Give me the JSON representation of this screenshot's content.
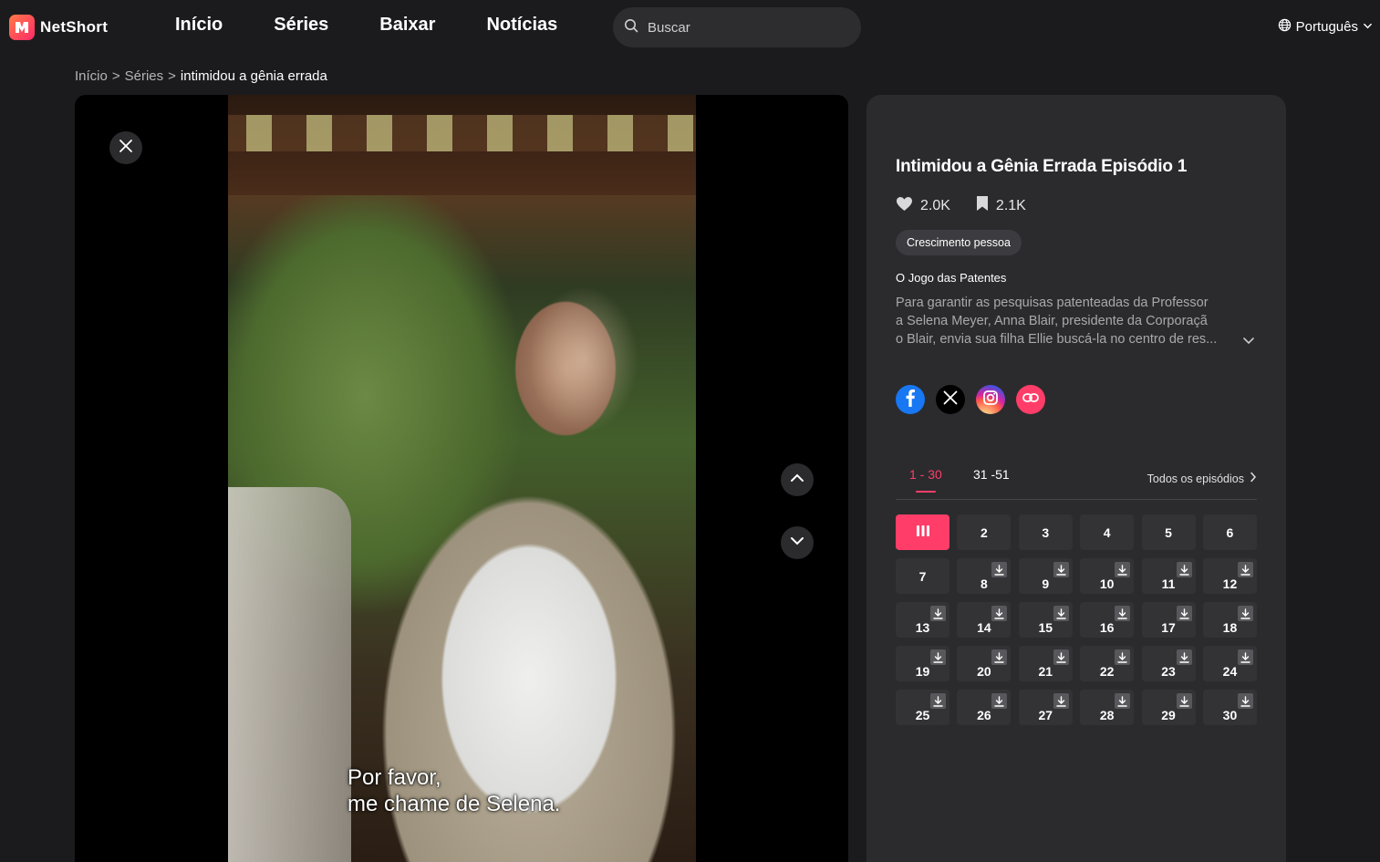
{
  "header": {
    "logo_text": "NetShort",
    "nav": [
      "Início",
      "Séries",
      "Baixar",
      "Notícias"
    ],
    "search_placeholder": "Buscar",
    "language": "Português"
  },
  "breadcrumb": {
    "home": "Início",
    "sep1": ">",
    "series": "Séries",
    "sep2": ">",
    "current": "intimidou a gênia errada"
  },
  "player": {
    "subtitle_line1": "Por favor,",
    "subtitle_line2": "me chame de Selena."
  },
  "info": {
    "title": "Intimidou a Gênia Errada Episódio 1",
    "likes": "2.0K",
    "saves": "2.1K",
    "tag": "Crescimento pessoa",
    "subheading": "O Jogo das Patentes",
    "description_lines": [
      "Para garantir as pesquisas patenteadas da Professor",
      "a Selena Meyer, Anna Blair, presidente da Corporaçã",
      "o Blair, envia sua filha Ellie buscá-la no centro de res..."
    ],
    "social": [
      "facebook-icon",
      "x-icon",
      "instagram-icon",
      "link-icon"
    ]
  },
  "episodes": {
    "tabs": [
      "1 - 30",
      "31 -51"
    ],
    "active_tab": "1 - 30",
    "all_label": "Todos os episódios",
    "playing": 1,
    "list": [
      {
        "n": "1",
        "dl": false
      },
      {
        "n": "2",
        "dl": false
      },
      {
        "n": "3",
        "dl": false
      },
      {
        "n": "4",
        "dl": false
      },
      {
        "n": "5",
        "dl": false
      },
      {
        "n": "6",
        "dl": false
      },
      {
        "n": "7",
        "dl": false
      },
      {
        "n": "8",
        "dl": true
      },
      {
        "n": "9",
        "dl": true
      },
      {
        "n": "10",
        "dl": true
      },
      {
        "n": "11",
        "dl": true
      },
      {
        "n": "12",
        "dl": true
      },
      {
        "n": "13",
        "dl": true
      },
      {
        "n": "14",
        "dl": true
      },
      {
        "n": "15",
        "dl": true
      },
      {
        "n": "16",
        "dl": true
      },
      {
        "n": "17",
        "dl": true
      },
      {
        "n": "18",
        "dl": true
      },
      {
        "n": "19",
        "dl": true
      },
      {
        "n": "20",
        "dl": true
      },
      {
        "n": "21",
        "dl": true
      },
      {
        "n": "22",
        "dl": true
      },
      {
        "n": "23",
        "dl": true
      },
      {
        "n": "24",
        "dl": true
      },
      {
        "n": "25",
        "dl": true
      },
      {
        "n": "26",
        "dl": true
      },
      {
        "n": "27",
        "dl": true
      },
      {
        "n": "28",
        "dl": true
      },
      {
        "n": "29",
        "dl": true
      },
      {
        "n": "30",
        "dl": true
      }
    ]
  },
  "colors": {
    "accent": "#ff3d68",
    "background": "#1b1b1d",
    "panel": "#2b2b2e"
  }
}
